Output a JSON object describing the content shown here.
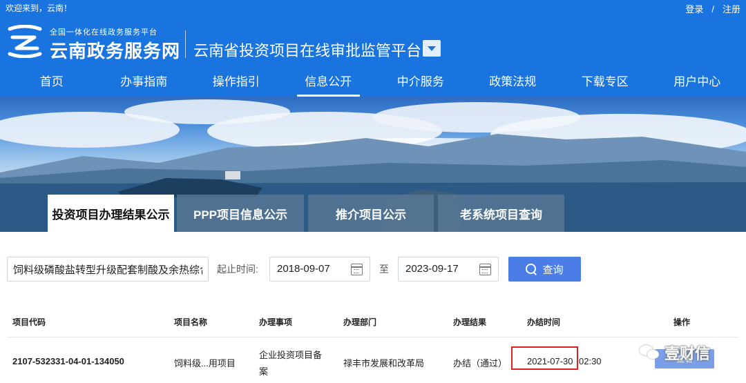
{
  "topbar": {
    "welcome": "欢迎来到，云南！",
    "login": "登录",
    "separator": "/",
    "register": "注册"
  },
  "brand": {
    "subtitle": "全国一体化在线政务服务平台",
    "name": "云南政务服务网",
    "platform": "云南省投资项目在线审批监管平台"
  },
  "nav": {
    "items": [
      "首页",
      "办事指南",
      "操作指引",
      "信息公开",
      "中介服务",
      "政策法规",
      "下载专区",
      "用户中心"
    ],
    "active_index": 3
  },
  "tabs": [
    "投资项目办理结果公示",
    "PPP项目信息公示",
    "推介项目公示",
    "老系统项目查询"
  ],
  "search": {
    "keyword": "饲料级磷酸盐转型升级配套制酸及余热综合利",
    "range_label": "起止时间:",
    "start_date": "2018-09-07",
    "to_label": "至",
    "end_date": "2023-09-17",
    "button_label": "查询"
  },
  "table": {
    "headers": [
      "项目代码",
      "项目名称",
      "办理事项",
      "办理部门",
      "办理结果",
      "办结时间",
      "操作"
    ],
    "rows": [
      {
        "code": "2107-532331-04-01-134050",
        "name": "饲料级...用项目",
        "matter_line1": "企业投资项目备",
        "matter_line2": "案",
        "department": "禄丰市发展和改革局",
        "result": "办结（通过）",
        "finish_date": "2021-07-30",
        "finish_time": "02:30",
        "action": "查看"
      }
    ]
  },
  "watermark": {
    "text": "壹财信"
  },
  "colors": {
    "primary": "#1a74e0",
    "button": "#4a7ee6",
    "highlight": "#e0201b"
  }
}
